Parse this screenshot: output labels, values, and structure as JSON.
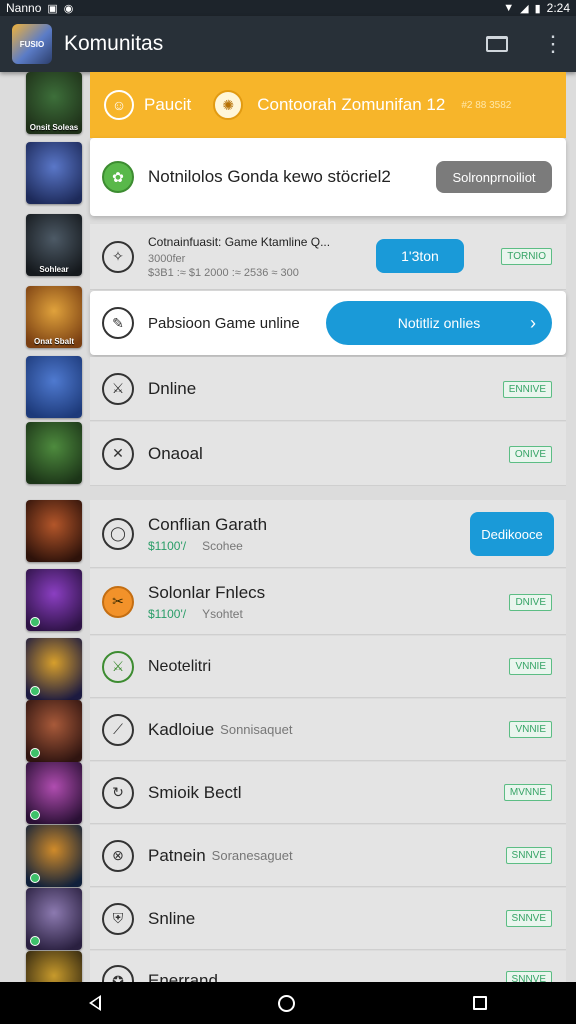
{
  "status_bar": {
    "carrier": "Nanno",
    "time": "2:24"
  },
  "app_bar": {
    "logo_text": "FUSIO",
    "title": "Komunitas"
  },
  "thumbs": [
    {
      "caption": "Onsit Soleas",
      "colors": [
        "#3d6f3a",
        "#1e2f18"
      ]
    },
    {
      "caption": "",
      "colors": [
        "#5a77c8",
        "#1d2a5a"
      ]
    },
    {
      "caption": "Sohlear",
      "colors": [
        "#4d5a66",
        "#15191d"
      ]
    },
    {
      "caption": "Onat Sbalt",
      "colors": [
        "#e0a23c",
        "#7a3f12"
      ]
    },
    {
      "caption": "",
      "colors": [
        "#4f7ad0",
        "#1d3a7a"
      ]
    },
    {
      "caption": "",
      "colors": [
        "#4e8b3e",
        "#1c3518"
      ]
    },
    {
      "caption": "",
      "colors": [
        "#b3562a",
        "#2e120a"
      ]
    },
    {
      "caption": "",
      "colors": [
        "#8b3fc2",
        "#2d1245"
      ]
    },
    {
      "caption": "",
      "colors": [
        "#d79f2c",
        "#1c1a40"
      ]
    },
    {
      "caption": "",
      "colors": [
        "#a85a3a",
        "#2f1410"
      ]
    },
    {
      "caption": "",
      "colors": [
        "#b04db0",
        "#2a1035"
      ]
    },
    {
      "caption": "",
      "colors": [
        "#d08b2a",
        "#10203a"
      ]
    },
    {
      "caption": "",
      "colors": [
        "#8c7ab0",
        "#2a2040"
      ]
    },
    {
      "caption": "",
      "colors": [
        "#c79a2c",
        "#2e2410"
      ]
    }
  ],
  "banner": {
    "title": "Paucit",
    "desc": "Contoorah Zomunifan 12",
    "meta": "#2 88 3582"
  },
  "rows": {
    "notif": {
      "title": "Notnilolos Gonda kewo stöcriel2",
      "button": "Solronprnoiliot"
    },
    "game_mode": {
      "title": "Cotnainfuasit: Game Ktamline Q...",
      "sub1": "3000fer",
      "sub2": "$3B1 :≈ $1 2000 :≈ 2536 ≈ 300",
      "button": "1'3ton",
      "pill": "TORNIO"
    },
    "passion": {
      "title": "Pabsioon Game unline",
      "button": "Notitliz onlies"
    },
    "online1": {
      "title": "Dnline",
      "pill": "ENNIVE"
    },
    "onanal": {
      "title": "Onaoal",
      "pill": "ONIVE"
    },
    "conflan": {
      "title": "Conflian Garath",
      "price": "$1100'/",
      "sub": "Scohee",
      "button": "Dedikooce"
    },
    "solonlar": {
      "title": "Solonlar Fnlecs",
      "price": "$1100'/",
      "sub": "Ysohtet",
      "pill": "DNIVE"
    },
    "neotelitri": {
      "title": "Neotelitri",
      "pill": "VNNIE"
    },
    "kadloiue": {
      "title": "Kadloiue",
      "sub": "Sonnisaquet",
      "pill": "VNNIE"
    },
    "smiloik": {
      "title": "Smioik Bectl",
      "pill": "MVNNE"
    },
    "patnein": {
      "title": "Patnein",
      "sub": "Soranesaguet",
      "pill": "SNNVE"
    },
    "snline": {
      "title": "Snline",
      "pill": "SNNVE"
    },
    "partial": {
      "title": "Enerrand",
      "pill": "SNNVE"
    }
  }
}
